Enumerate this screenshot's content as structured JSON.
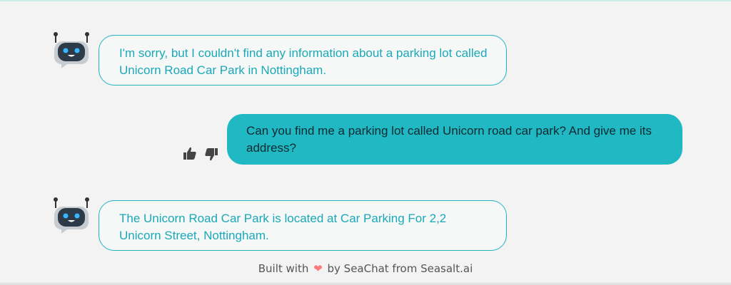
{
  "messages": [
    {
      "role": "bot",
      "text": "I'm sorry, but I couldn't find any information about a parking lot called Unicorn Road Car Park in Nottingham."
    },
    {
      "role": "user",
      "text": "Can you find me a parking lot called Unicorn road car park? And give me its address?"
    },
    {
      "role": "bot",
      "text": "The Unicorn Road Car Park is located at Car Parking For 2,2 Unicorn Street, Nottingham."
    }
  ],
  "feedback": {
    "thumbs_up_icon": "thumbs-up-icon",
    "thumbs_down_icon": "thumbs-down-icon"
  },
  "footer": {
    "prefix": "Built with",
    "heart_icon": "heart-icon",
    "suffix": "by SeaChat from Seasalt.ai"
  },
  "colors": {
    "accent": "#1fb8c3",
    "bot_text": "#1aa9b8",
    "background": "#f3f3f3"
  }
}
